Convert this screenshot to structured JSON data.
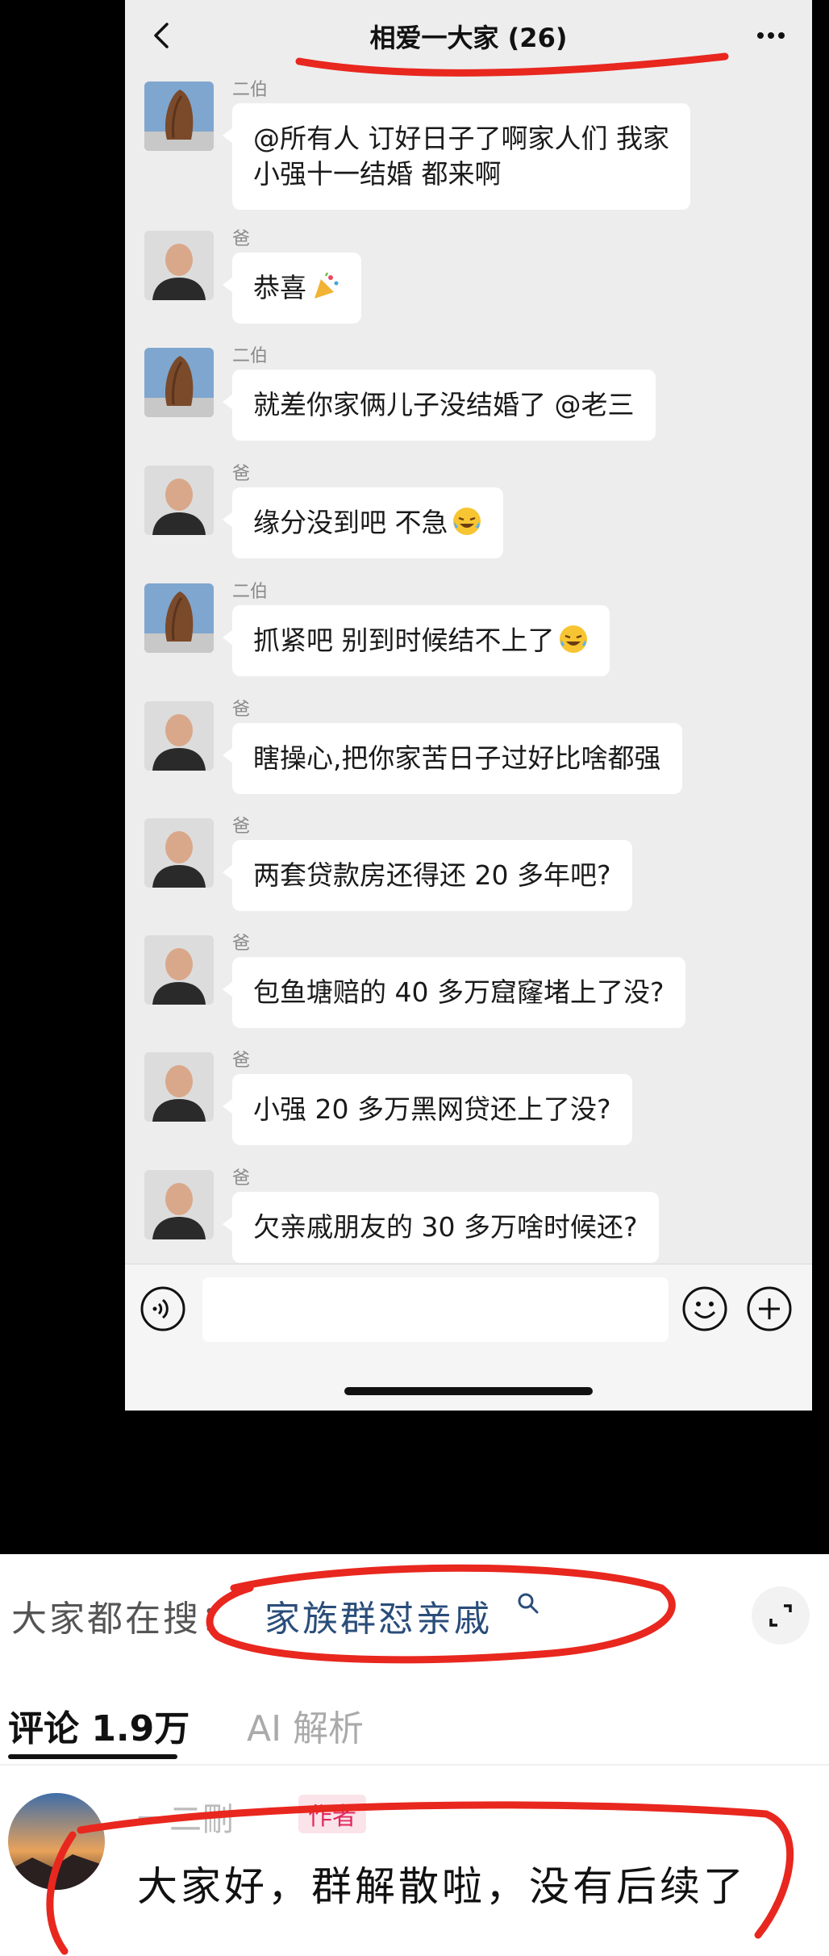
{
  "chat": {
    "title": "相爱一大家 (26)"
  },
  "messages": [
    {
      "sender": "二伯",
      "avatar": "rock-avatar",
      "text": "@所有人 订好日子了啊家人们 我家\n小强十一结婚  都来啊",
      "emoji": ""
    },
    {
      "sender": "爸",
      "avatar": "man-avatar",
      "text": "恭喜",
      "emoji": "party-popper-icon"
    },
    {
      "sender": "二伯",
      "avatar": "rock-avatar",
      "text": "就差你家俩儿子没结婚了 @老三",
      "emoji": ""
    },
    {
      "sender": "爸",
      "avatar": "man-avatar",
      "text": "缘分没到吧 不急",
      "emoji": "laugh-cry-icon"
    },
    {
      "sender": "二伯",
      "avatar": "rock-avatar",
      "text": "抓紧吧 别到时候结不上了",
      "emoji": "laugh-cry-icon"
    },
    {
      "sender": "爸",
      "avatar": "man-avatar",
      "text": "瞎操心,把你家苦日子过好比啥都强",
      "emoji": ""
    },
    {
      "sender": "爸",
      "avatar": "man-avatar",
      "text": "两套贷款房还得还 20 多年吧?",
      "emoji": ""
    },
    {
      "sender": "爸",
      "avatar": "man-avatar",
      "text": "包鱼塘赔的 40 多万窟窿堵上了没?",
      "emoji": ""
    },
    {
      "sender": "爸",
      "avatar": "man-avatar",
      "text": "小强 20 多万黑网贷还上了没?",
      "emoji": ""
    },
    {
      "sender": "爸",
      "avatar": "man-avatar",
      "text": "欠亲戚朋友的 30 多万啥时候还?",
      "emoji": ""
    }
  ],
  "search_suggest": {
    "label": "大家都在搜：",
    "term": "家族群怼亲戚"
  },
  "tabs": {
    "comments_label": "评论 1.9万",
    "ai_label": "AI 解析"
  },
  "comment": {
    "username": "一二刪",
    "badge": "作者",
    "text": "大家好，群解散啦，没有后续了"
  },
  "colors": {
    "chat_bg": "#ededed",
    "bubble_bg": "#ffffff",
    "annotation_red": "#e8271f",
    "search_term_blue": "#2a4d7a",
    "author_badge": "#e0285c"
  }
}
